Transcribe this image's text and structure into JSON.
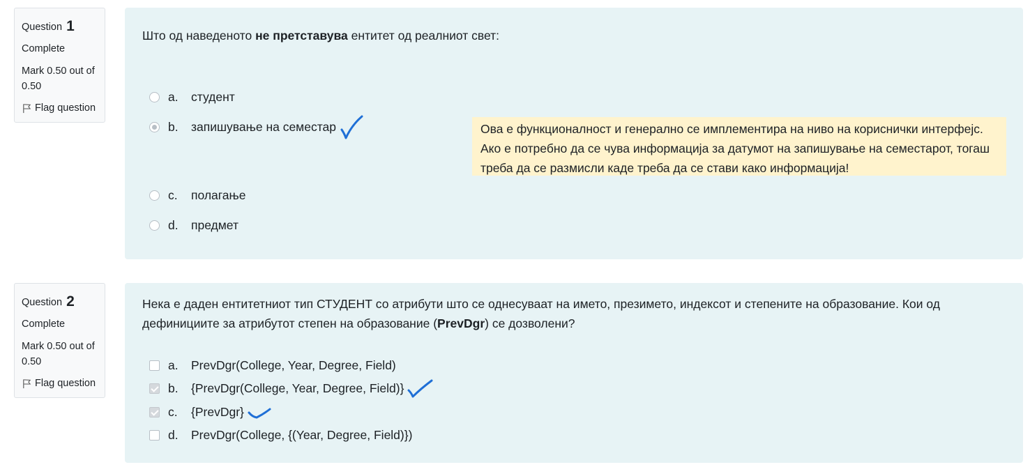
{
  "questions": [
    {
      "label": "Question",
      "number": "1",
      "state": "Complete",
      "mark": "Mark 0.50 out of 0.50",
      "flag": "Flag question",
      "text_before": "Што од наведеното ",
      "text_bold": "не претставува",
      "text_after": " ентитет од реалниот свет:",
      "options": [
        {
          "letter": "a.",
          "text": "студент",
          "checked": false
        },
        {
          "letter": "b.",
          "text": "запишување на семестар",
          "checked": true
        },
        {
          "letter": "c.",
          "text": "полагање",
          "checked": false
        },
        {
          "letter": "d.",
          "text": "предмет",
          "checked": false
        }
      ],
      "feedback": "Ова е функционалност и генерално се имплементира на ниво на кориснички интерфејс. Ако е потребно да се чува информација за датумот на запишување на семестарот, тогаш треба да се размисли каде треба да се стави како информација!"
    },
    {
      "label": "Question",
      "number": "2",
      "state": "Complete",
      "mark": "Mark 0.50 out of 0.50",
      "flag": "Flag question",
      "text_before": "Нека е даден ентитетниот тип СТУДЕНТ со атрибути што се однесуваат на името, презимето, индексот и степените на образование. Кои од дефинициите за атрибутот степен на образование (",
      "text_bold": "PrevDgr",
      "text_after": ") се дозволени?",
      "options": [
        {
          "letter": "a.",
          "text": "PrevDgr(College, Year, Degree, Field)",
          "checked": false
        },
        {
          "letter": "b.",
          "text": "{PrevDgr(College, Year, Degree, Field)}",
          "checked": true
        },
        {
          "letter": "c.",
          "text": "{PrevDgr}",
          "checked": true
        },
        {
          "letter": "d.",
          "text": "PrevDgr(College, {(Year, Degree, Field)})",
          "checked": false
        }
      ]
    }
  ],
  "colors": {
    "content_bg": "#e7f3f5",
    "feedback_bg": "#fff3cd",
    "info_bg": "#f8f9fa",
    "handwritten_tick": "#1f6fd6"
  }
}
